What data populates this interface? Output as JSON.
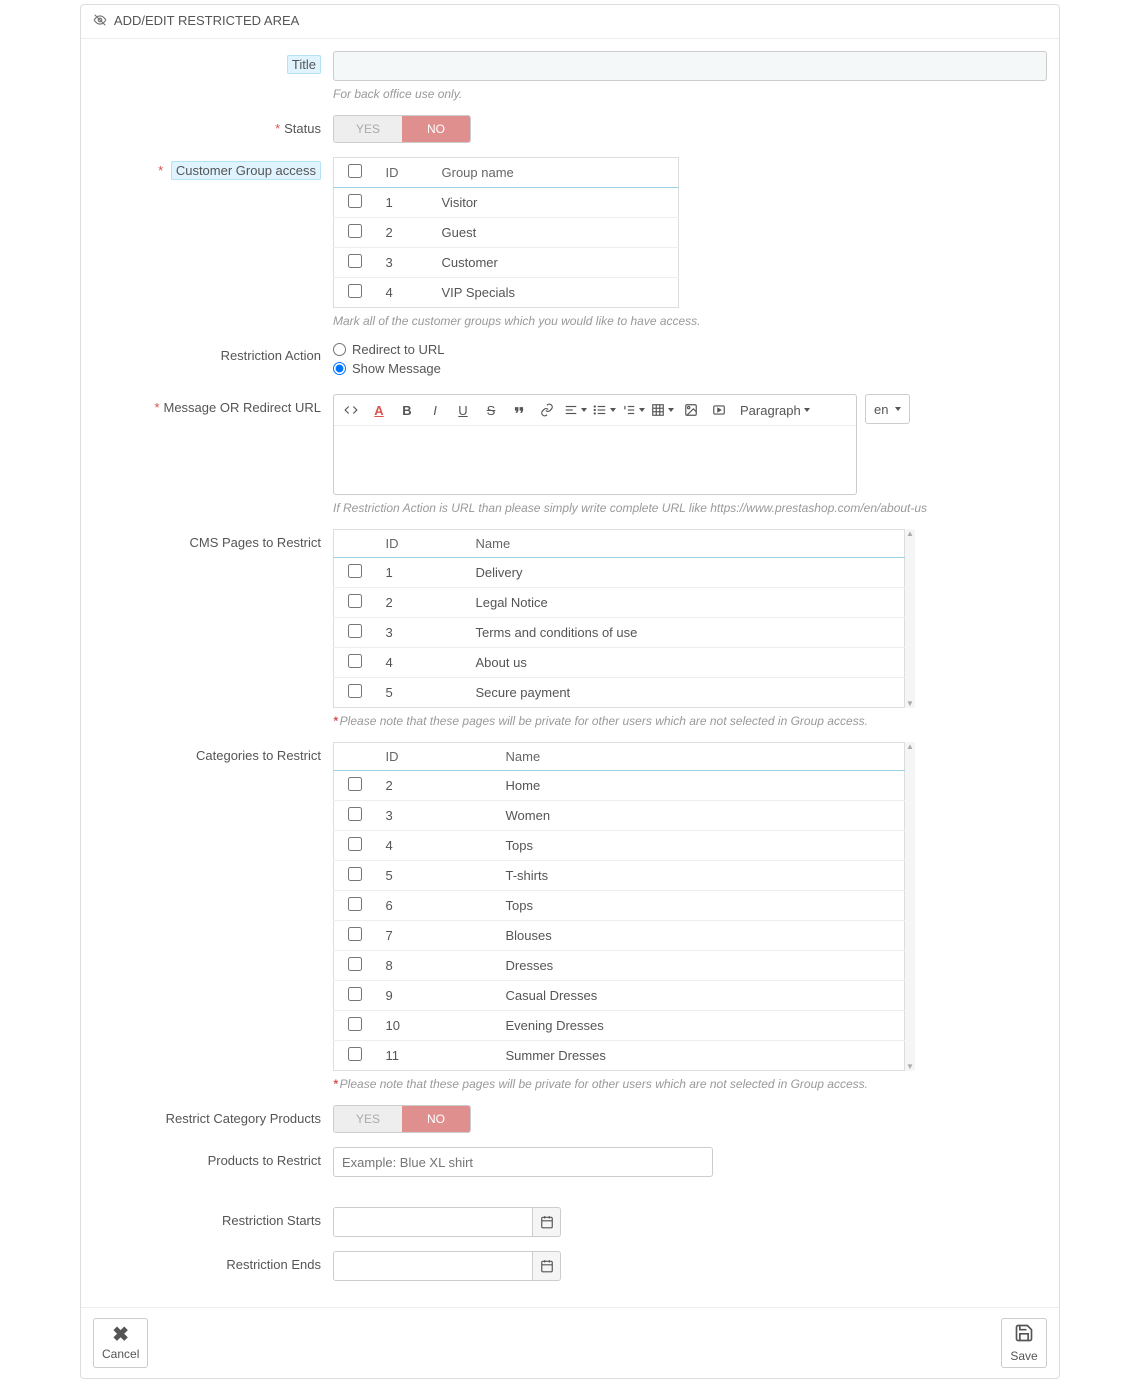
{
  "header": {
    "title": "ADD/EDIT RESTRICTED AREA"
  },
  "title_field": {
    "label": "Title",
    "value": "",
    "help": "For back office use only."
  },
  "status": {
    "label": "Status",
    "yes": "YES",
    "no": "NO"
  },
  "group_access": {
    "label": "Customer Group access",
    "col_id": "ID",
    "col_name": "Group name",
    "rows": [
      {
        "id": "1",
        "name": "Visitor"
      },
      {
        "id": "2",
        "name": "Guest"
      },
      {
        "id": "3",
        "name": "Customer"
      },
      {
        "id": "4",
        "name": "VIP Specials"
      }
    ],
    "help": "Mark all of the customer groups which you would like to have access."
  },
  "restriction_action": {
    "label": "Restriction Action",
    "opt_redirect": "Redirect to URL",
    "opt_message": "Show Message"
  },
  "message_field": {
    "label": "Message OR Redirect URL",
    "help": "If Restriction Action is URL than please simply write complete URL like https://www.prestashop.com/en/about-us",
    "paragraph_label": "Paragraph",
    "lang": "en"
  },
  "cms_pages": {
    "label": "CMS Pages to Restrict",
    "col_id": "ID",
    "col_name": "Name",
    "rows": [
      {
        "id": "1",
        "name": "Delivery"
      },
      {
        "id": "2",
        "name": "Legal Notice"
      },
      {
        "id": "3",
        "name": "Terms and conditions of use"
      },
      {
        "id": "4",
        "name": "About us"
      },
      {
        "id": "5",
        "name": "Secure payment"
      }
    ],
    "help": "Please note that these pages will be private for other users which are not selected in Group access."
  },
  "categories": {
    "label": "Categories to Restrict",
    "col_id": "ID",
    "col_name": "Name",
    "rows": [
      {
        "id": "2",
        "name": "Home"
      },
      {
        "id": "3",
        "name": "Women"
      },
      {
        "id": "4",
        "name": "Tops"
      },
      {
        "id": "5",
        "name": "T-shirts"
      },
      {
        "id": "6",
        "name": "Tops"
      },
      {
        "id": "7",
        "name": "Blouses"
      },
      {
        "id": "8",
        "name": "Dresses"
      },
      {
        "id": "9",
        "name": "Casual Dresses"
      },
      {
        "id": "10",
        "name": "Evening Dresses"
      },
      {
        "id": "11",
        "name": "Summer Dresses"
      }
    ],
    "help": "Please note that these pages will be private for other users which are not selected in Group access."
  },
  "restrict_cat_products": {
    "label": "Restrict Category Products",
    "yes": "YES",
    "no": "NO"
  },
  "products_restrict": {
    "label": "Products to Restrict",
    "placeholder": "Example: Blue XL shirt"
  },
  "restriction_starts": {
    "label": "Restriction Starts"
  },
  "restriction_ends": {
    "label": "Restriction Ends"
  },
  "footer": {
    "cancel": "Cancel",
    "save": "Save"
  }
}
